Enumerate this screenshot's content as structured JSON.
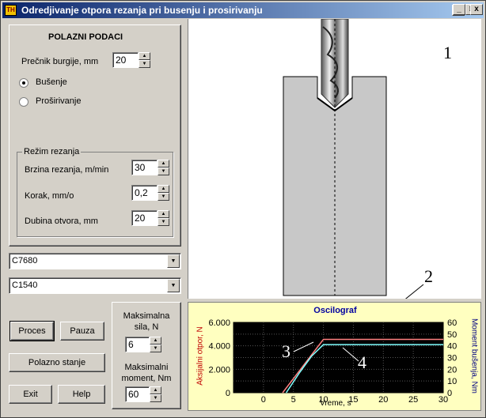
{
  "window": {
    "title": "Odredjivanje otpora rezanja pri busenju i prosirivanju",
    "icon_text": "TH",
    "controls": [
      "_",
      "□",
      "x"
    ]
  },
  "input_panel": {
    "heading": "POLAZNI PODACI",
    "diameter_label": "Prečnik burgije, mm",
    "diameter_value": "20",
    "radio_drilling": "Bušenje",
    "radio_reaming": "Proširivanje",
    "selected_mode": "Bušenje",
    "regime_group": "Režim rezanja",
    "speed_label": "Brzina rezanja, m/min",
    "speed_value": "30",
    "feed_label": "Korak, mm/o",
    "feed_value": "0,2",
    "depth_label": "Dubina otvora, mm",
    "depth_value": "20"
  },
  "combos": {
    "material1": "C7680",
    "material2": "C1540"
  },
  "buttons": {
    "process": "Proces",
    "pause": "Pauza",
    "reset": "Polazno stanje",
    "exit": "Exit",
    "help": "Help"
  },
  "max_panel": {
    "max_force_label_1": "Maksimalna",
    "max_force_label_2": "sila, N",
    "max_force_value": "6",
    "max_moment_label_1": "Maksimalni",
    "max_moment_label_2": "moment, Nm",
    "max_moment_value": "60"
  },
  "annotations": {
    "one": "1",
    "two": "2",
    "three": "3",
    "four": "4"
  },
  "chart_data": {
    "type": "line",
    "title": "Oscilograf",
    "xlabel": "Vreme, s",
    "ylabel_left": "Aksijalni otpor, N",
    "ylabel_right": "Moment bušenja, Nm",
    "xlim": [
      -5,
      30
    ],
    "ylim_left": [
      0,
      6000
    ],
    "ylim_right": [
      0,
      60
    ],
    "xticks": [
      "0",
      "5",
      "10",
      "15",
      "20",
      "25",
      "30"
    ],
    "xtick_values": [
      0,
      5,
      10,
      15,
      20,
      25,
      30
    ],
    "yticks_left": [
      "0",
      "2.000",
      "4.000",
      "6.000"
    ],
    "ytick_left_values": [
      0,
      2000,
      4000,
      6000
    ],
    "yticks_right": [
      "0",
      "10",
      "20",
      "30",
      "40",
      "50",
      "60"
    ],
    "ytick_right_values": [
      0,
      10,
      20,
      30,
      40,
      50,
      60
    ],
    "grid": true,
    "series": [
      {
        "color": "#ff8080",
        "axis": "left",
        "x": [
          3.2,
          10,
          30
        ],
        "y": [
          0,
          4550,
          4550
        ]
      },
      {
        "color": "#80ffff",
        "axis": "right",
        "x": [
          3.8,
          6,
          8,
          10,
          30
        ],
        "y": [
          0,
          17,
          31,
          41,
          41
        ]
      }
    ]
  }
}
